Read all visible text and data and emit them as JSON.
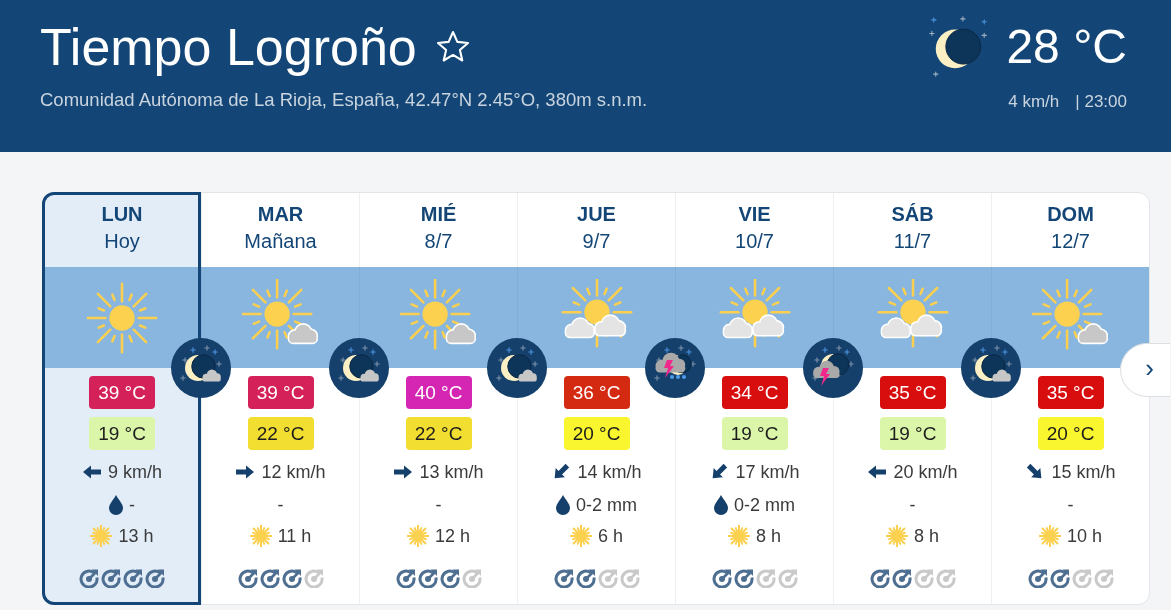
{
  "header": {
    "title": "Tiempo Logroño",
    "favorite": false,
    "subtitle": "Comunidad Autónoma de La Rioja, España, 42.47°N 2.45°O, 380m s.n.m.",
    "current": {
      "temperature": "28 °C",
      "wind": "4 km/h",
      "time": "| 23:00"
    }
  },
  "days": [
    {
      "selected": true,
      "day": "LUN",
      "date": "Hoy",
      "sky": {
        "kind": "sun"
      },
      "night": {
        "kind": "moon-cloud"
      },
      "max": {
        "text": "39 °C",
        "color": "#d5215a"
      },
      "min": {
        "text": "19 °C",
        "color": "#dbf5a9"
      },
      "wind_icon": {
        "kind": "left"
      },
      "wind": "9 km/h",
      "rain_drop": true,
      "rain": "-",
      "sun_hours": "13 h",
      "stars": 4
    },
    {
      "selected": false,
      "day": "MAR",
      "date": "Mañana",
      "sky": {
        "kind": "sun-cloud"
      },
      "night": {
        "kind": "moon-cloud"
      },
      "max": {
        "text": "39 °C",
        "color": "#d5215a"
      },
      "min": {
        "text": "22 °C",
        "color": "#f1de30"
      },
      "wind_icon": {
        "kind": "right"
      },
      "wind": "12 km/h",
      "rain_drop": false,
      "rain": "-",
      "sun_hours": "11 h",
      "stars": 3
    },
    {
      "selected": false,
      "day": "MIÉ",
      "date": "8/7",
      "sky": {
        "kind": "sun-cloud"
      },
      "night": {
        "kind": "moon-cloud"
      },
      "max": {
        "text": "40 °C",
        "color": "#d426b2"
      },
      "min": {
        "text": "22 °C",
        "color": "#f1de30"
      },
      "wind_icon": {
        "kind": "right"
      },
      "wind": "13 km/h",
      "rain_drop": false,
      "rain": "-",
      "sun_hours": "12 h",
      "stars": 3
    },
    {
      "selected": false,
      "day": "JUE",
      "date": "9/7",
      "sky": {
        "kind": "sun-clouds"
      },
      "night": {
        "kind": "storm-rain"
      },
      "max": {
        "text": "36 °C",
        "color": "#d42a12"
      },
      "min": {
        "text": "20 °C",
        "color": "#f9f52e"
      },
      "wind_icon": {
        "kind": "down-left"
      },
      "wind": "14 km/h",
      "rain_drop": true,
      "rain": "0-2 mm",
      "sun_hours": "6 h",
      "stars": 2
    },
    {
      "selected": false,
      "day": "VIE",
      "date": "10/7",
      "sky": {
        "kind": "sun-clouds"
      },
      "night": {
        "kind": "moon-storm"
      },
      "max": {
        "text": "34 °C",
        "color": "#d80e0e"
      },
      "min": {
        "text": "19 °C",
        "color": "#dbf5a9"
      },
      "wind_icon": {
        "kind": "down-left"
      },
      "wind": "17 km/h",
      "rain_drop": true,
      "rain": "0-2 mm",
      "sun_hours": "8 h",
      "stars": 2
    },
    {
      "selected": false,
      "day": "SÁB",
      "date": "11/7",
      "sky": {
        "kind": "sun-clouds"
      },
      "night": {
        "kind": "moon-cloud"
      },
      "max": {
        "text": "35 °C",
        "color": "#d80e0e"
      },
      "min": {
        "text": "19 °C",
        "color": "#dbf5a9"
      },
      "wind_icon": {
        "kind": "left"
      },
      "wind": "20 km/h",
      "rain_drop": false,
      "rain": "-",
      "sun_hours": "8 h",
      "stars": 2
    },
    {
      "selected": false,
      "day": "DOM",
      "date": "12/7",
      "sky": {
        "kind": "sun-cloud"
      },
      "max": {
        "text": "35 °C",
        "color": "#d80e0e"
      },
      "min": {
        "text": "20 °C",
        "color": "#f9f52e"
      },
      "wind_icon": {
        "kind": "down-right"
      },
      "wind": "15 km/h",
      "rain_drop": false,
      "rain": "-",
      "sun_hours": "10 h",
      "stars": 2
    }
  ],
  "next_button": {
    "label": "›"
  }
}
